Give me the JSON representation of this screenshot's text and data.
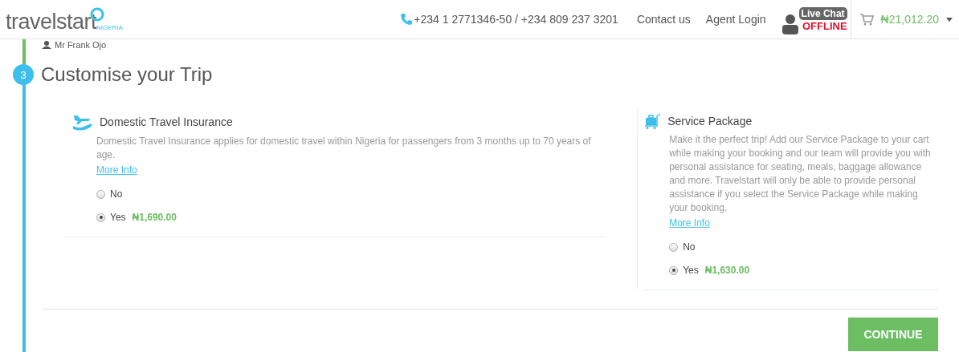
{
  "header": {
    "logo": "travelstart",
    "logo_sub": "NIGERIA",
    "phone": "+234 1 2771346-50 / +234 809 237 3201",
    "links": [
      "Contact us",
      "Agent Login"
    ],
    "live_chat": {
      "label": "Live Chat",
      "status": "OFFLINE"
    },
    "cart_total": "₦21,012.20"
  },
  "passenger": "Mr Frank Ojo",
  "step": {
    "number": "3",
    "title": "Customise your Trip"
  },
  "products": [
    {
      "kind": "insurance",
      "title": "Domestic Travel Insurance",
      "description": "Domestic Travel Insurance applies for domestic travel within Nigeria for passengers from 3 months up to 70 years of age.",
      "link": "More Info",
      "options": [
        {
          "label": "No",
          "selected": false
        },
        {
          "label": "Yes",
          "selected": true,
          "price": "₦1,690.00"
        }
      ]
    },
    {
      "kind": "service",
      "title": "Service Package",
      "description": "Make it the perfect trip! Add our Service Package to your cart while making your booking and our team will provide you with personal assistance for seating, meals, baggage allowance and more. Travelstart will only be able to provide personal assistance if you select the Service Package while making your booking.",
      "link": "More Info",
      "options": [
        {
          "label": "No",
          "selected": false
        },
        {
          "label": "Yes",
          "selected": true,
          "price": "₦1,630.00"
        }
      ]
    }
  ],
  "continue_button": "CONTINUE"
}
